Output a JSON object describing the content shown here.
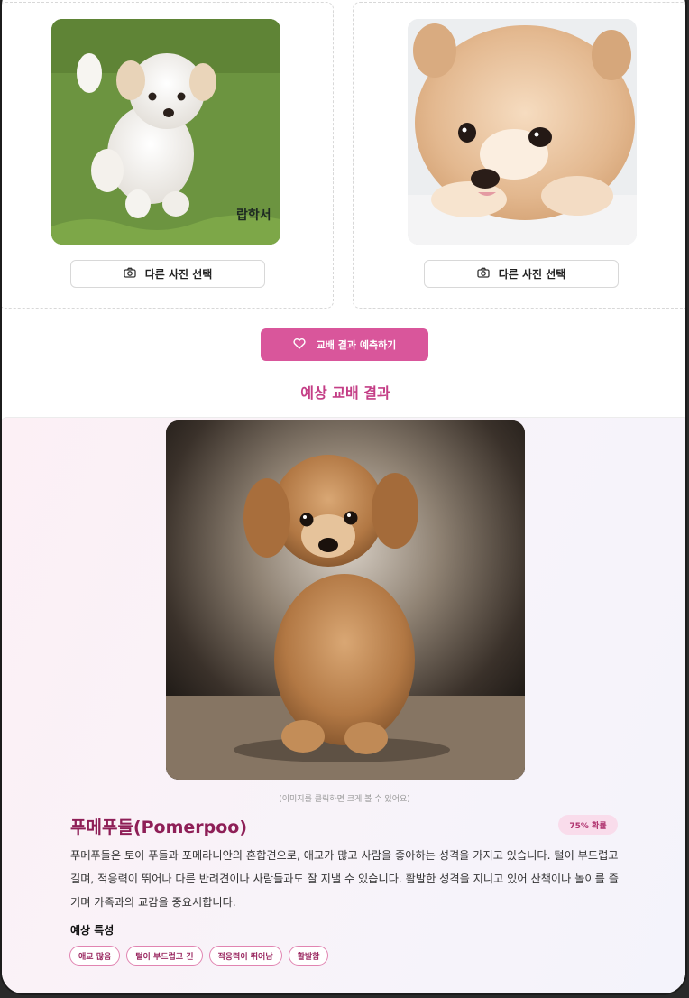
{
  "cards": [
    {
      "photo_alt": "흰색 말티푸 강아지",
      "button_label": "다른 사진 선택",
      "watermark": "랍학서"
    },
    {
      "photo_alt": "포메라니안 강아지",
      "button_label": "다른 사진 선택"
    }
  ],
  "predict_button_label": "교배 결과 예측하기",
  "section_title": "예상 교배 결과",
  "result": {
    "hint": "(이미지를 클릭하면 크게 볼 수 있어요)",
    "breed_name": "푸메푸들(Pomerpoo)",
    "probability": "75% 확률",
    "description": "푸메푸들은 토이 푸들과 포메라니안의 혼합견으로, 애교가 많고 사람을 좋아하는 성격을 가지고 있습니다. 털이 부드럽고 길며, 적응력이 뛰어나 다른 반려견이나 사람들과도 잘 지낼 수 있습니다. 활발한 성격을 지니고 있어 산책이나 놀이를 즐기며 가족과의 교감을 중요시합니다.",
    "traits_title": "예상 특성",
    "traits": [
      "애교 많음",
      "털이 부드럽고 긴",
      "적응력이 뛰어남",
      "활발함"
    ]
  },
  "colors": {
    "accent": "#d9569b",
    "title": "#c43e86",
    "breed_name": "#8e1f57"
  },
  "icons": {
    "camera": "camera-icon",
    "heart": "heart-icon"
  }
}
